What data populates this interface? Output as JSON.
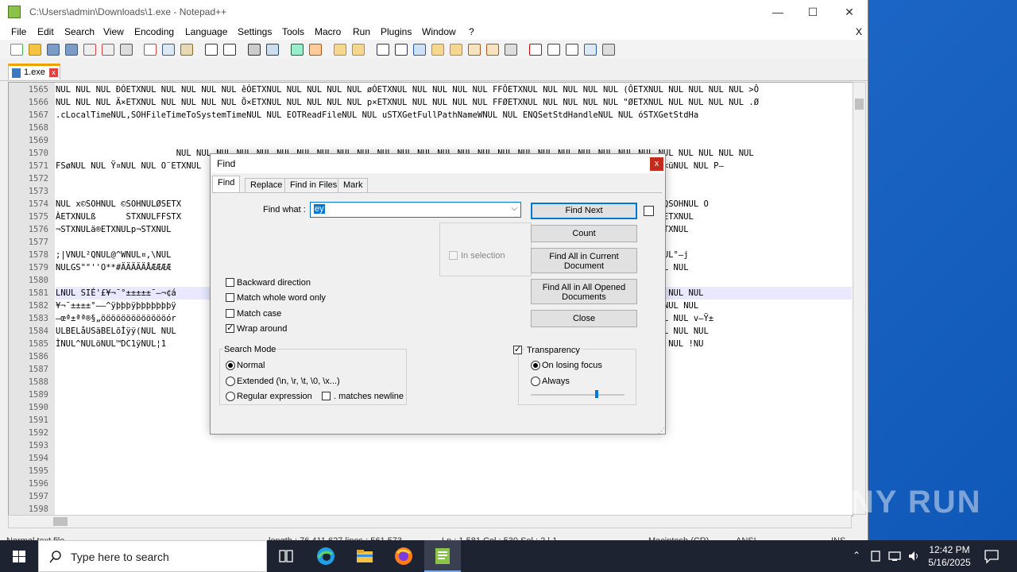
{
  "window": {
    "title": "C:\\Users\\admin\\Downloads\\1.exe - Notepad++",
    "minimize": "—",
    "maximize": "☐",
    "close": "✕"
  },
  "menu": [
    "File",
    "Edit",
    "Search",
    "View",
    "Encoding",
    "Language",
    "Settings",
    "Tools",
    "Macro",
    "Run",
    "Plugins",
    "Window",
    "?"
  ],
  "menu_close": "X",
  "tab": {
    "name": "1.exe",
    "close": "x"
  },
  "editor": {
    "lines": [
      {
        "n": "1565",
        "t": "NUL NUL NUL ÐÓETXNUL NUL NUL NUL NUL êÓETXNUL NUL NUL NUL NUL øÓETXNUL NUL NUL NUL NUL FFÔETXNUL NUL NUL NUL NUL (ÔETXNUL NUL NUL NUL NUL >Ô"
      },
      {
        "n": "1566",
        "t": "NUL NUL NUL Ä×ETXNUL NUL NUL NUL NUL Ö×ETXNUL NUL NUL NUL NUL p×ETXNUL NUL NUL NUL NUL FFØETXNUL NUL NUL NUL NUL \"ØETXNUL NUL NUL NUL NUL .Ø"
      },
      {
        "n": "1567",
        "t": ".cLocalTimeNUL,SOHFileTimeToSystemTimeNUL NUL EOTReadFileNUL NUL uSTXGetFullPathNameWNUL NUL ENQSetStdHandleNUL NUL óSTXGetStdHa"
      },
      {
        "n": "1568",
        "t": ""
      },
      {
        "n": "1569",
        "t": ""
      },
      {
        "n": "1570",
        "t": "                        NUL NUL NUL NUL NUL NUL NUL NUL NUL NUL NUL NUL NUL NUL NUL NUL NUL NUL NUL NUL NUL NUL NUL NUL NUL NUL NUL NUL NUL"
      },
      {
        "n": "1571",
        "t": "FSøNUL NUL Ÿ¤NUL NUL O¨ETXNUL                                                                        NULhETXNUL´ûNUL NUL <üNUL NUL P–"
      },
      {
        "n": "1572",
        "t": ""
      },
      {
        "n": "1573",
        "t": ""
      },
      {
        "n": "1574",
        "t": "NUL x©SOHNUL ©SOHNULØSETX                                                                            LX²ETXNUL dQSOHNUL ÎQSOHNUL O"
      },
      {
        "n": "1575",
        "t": "ÀETXNULß      STXNULFFSTX                                                                           DLESTXNULÉDC1STXNULà,ETXNUL"
      },
      {
        "n": "1576",
        "t": "¬STXNULä®ETXNULp¬STXNUL                                                                            NUL_–STXNULy–STXNUL|´ETXNUL"
      },
      {
        "n": "1577",
        "t": ""
      },
      {
        "n": "1578",
        "t": ";|VNUL²QNUL@^WNUL¤,\\NUL                                                                            UL¬kNUL¯nNUL³`eNUL²'hNUL°–j"
      },
      {
        "n": "1579",
        "t": "NULGS\"\"''O**#ÄÄÄÄÄÅÆÆÆÆ                                                                           êÅ<TTTZTTTTT¼NUL NUL NUL NUL"
      },
      {
        "n": "1580",
        "t": ""
      },
      {
        "n": "1581",
        "t": "LNUL SIÉ'£¥¬¯°±±±±±¯–¬¢á                                                                           ÷÷÷÷÷÷÷÷ÐSSNUL NUL NUL NUL NUL"
      },
      {
        "n": "1582",
        "t": "¥¬¯±±±±°––^ÿþþþÿþþþþþþþÿ                                                                           þþþÜMMNUL NUL NUL NUL NUL NUL"
      },
      {
        "n": "1583",
        "t": "–œª±ªª®§„öööööööööööööór                                                                           öööööö÷öööoHNUL NUL NUL NUL v–Ÿ±"
      },
      {
        "n": "1584",
        "t": "ULBELåUSäBELõÌÿÿ(NUL NUL                                                                            UL NUL NUL NUL NUL NUL NUL NUL"
      },
      {
        "n": "1585",
        "t": "ÌNUL^NULöNUL™DC1ÿNUL¦1                                                                              PNULNAKNUL pNULESCNUL NUL !NU"
      },
      {
        "n": "1586",
        "t": ""
      },
      {
        "n": "1587",
        "t": ""
      },
      {
        "n": "1588",
        "t": ""
      },
      {
        "n": "1589",
        "t": ""
      },
      {
        "n": "1590",
        "t": ""
      },
      {
        "n": "1591",
        "t": ""
      },
      {
        "n": "1592",
        "t": ""
      },
      {
        "n": "1593",
        "t": ""
      },
      {
        "n": "1594",
        "t": ""
      },
      {
        "n": "1595",
        "t": ""
      },
      {
        "n": "1596",
        "t": ""
      },
      {
        "n": "1597",
        "t": ""
      },
      {
        "n": "1598",
        "t": ""
      }
    ]
  },
  "status": {
    "type": "Normal text file",
    "length": "length : 76,411,627   lines : 561,573",
    "pos": "Ln : 1,581    Col : 530    Sel : 2 | 1",
    "eol": "Macintosh (CR)",
    "enc": "ANSI",
    "ins": "INS"
  },
  "find_dialog": {
    "title": "Find",
    "close": "x",
    "tabs": [
      "Find",
      "Replace",
      "Find in Files",
      "Mark"
    ],
    "find_what_label": "Find what :",
    "find_what_value": "ey",
    "in_selection_label": "In selection",
    "buttons": {
      "find_next": "Find Next",
      "count": "Count",
      "find_all_current": "Find All in Current Document",
      "find_all_opened": "Find All in All Opened Documents",
      "close": "Close"
    },
    "options": {
      "backward": "Backward direction",
      "whole_word": "Match whole word only",
      "match_case": "Match case",
      "wrap_around": "Wrap around"
    },
    "search_mode": {
      "title": "Search Mode",
      "normal": "Normal",
      "extended": "Extended (\\n, \\r, \\t, \\0, \\x...)",
      "regex": "Regular expression",
      "matches_newline": ". matches newline"
    },
    "transparency": {
      "title": "Transparency",
      "on_losing_focus": "On losing focus",
      "always": "Always",
      "slider_level": 0.7
    }
  },
  "taskbar": {
    "search_placeholder": "Type here to search",
    "time": "12:42 PM",
    "date": "5/16/2025"
  },
  "watermark": "ANY RUN"
}
